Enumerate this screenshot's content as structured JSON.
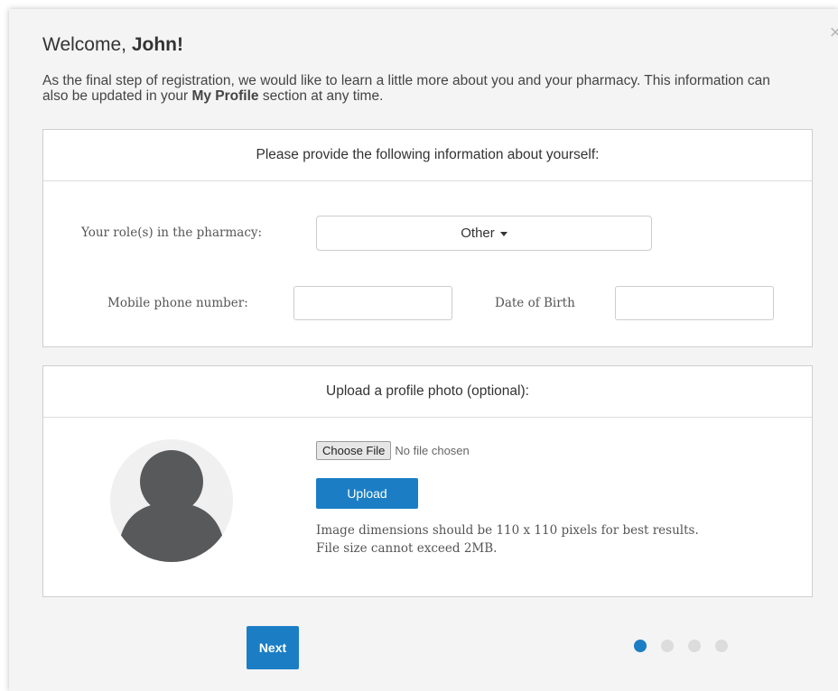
{
  "modal": {
    "close_glyph": "×",
    "welcome_prefix": "Welcome, ",
    "user_name": "John!",
    "intro_part1": "As the final step of registration, we would like to learn a little more about you and your pharmacy. This information can also be updated in your ",
    "intro_link": "My Profile",
    "intro_part2": " section at any time."
  },
  "about": {
    "heading": "Please provide the following information about yourself:",
    "role_label": "Your role(s) in the pharmacy:",
    "role_value": "Other",
    "mobile_label": "Mobile phone number:",
    "mobile_value": "",
    "dob_label": "Date of Birth",
    "dob_value": ""
  },
  "photo": {
    "heading": "Upload a profile photo (optional):",
    "choose_label": "Choose File",
    "no_file_text": "No file chosen",
    "upload_label": "Upload",
    "hint_line1": "Image dimensions should be 110 x 110 pixels for best results.",
    "hint_line2": "File size cannot exceed 2MB."
  },
  "footer": {
    "next_label": "Next",
    "steps_total": 4,
    "current_step": 1
  },
  "colors": {
    "accent": "#1b7ec5",
    "avatar": "#58595b",
    "inactive_dot": "#dcdcdc"
  }
}
